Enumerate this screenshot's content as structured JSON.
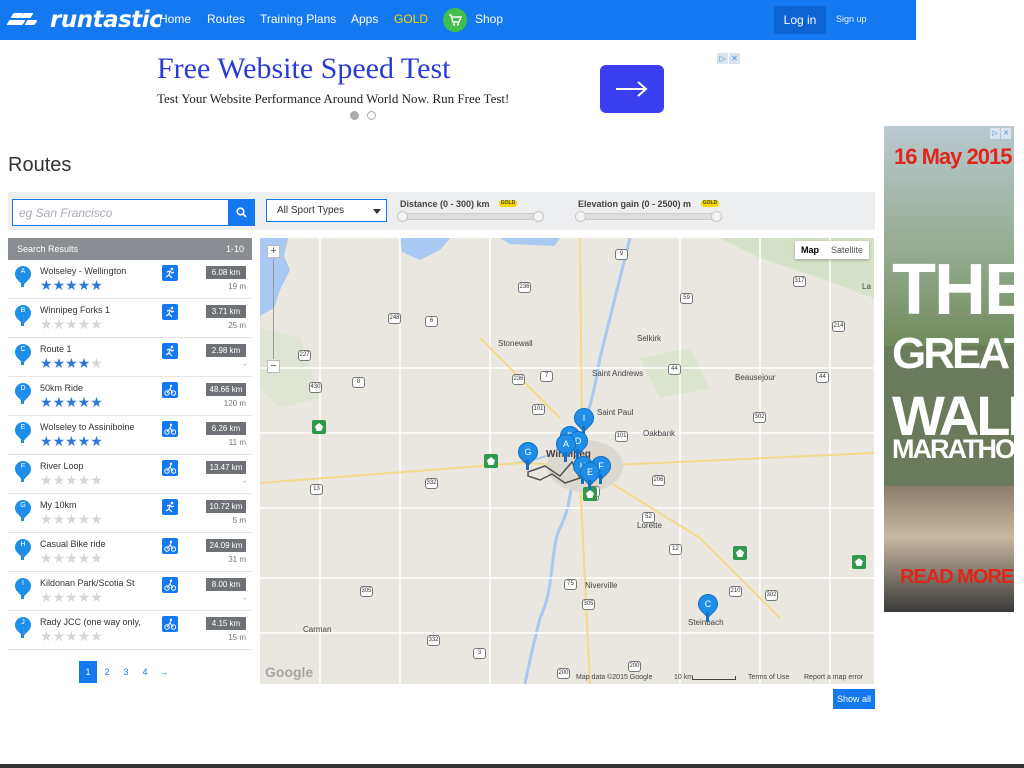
{
  "nav": {
    "brand": "runtastic",
    "links": [
      "Home",
      "Routes",
      "Training Plans",
      "Apps",
      "GOLD",
      "Shop"
    ],
    "login": "Log in",
    "signup": "Sign up"
  },
  "ad_top": {
    "title": "Free Website Speed Test",
    "subtitle": "Test Your Website Performance Around World Now. Run Free Test!"
  },
  "page_title": "Routes",
  "filters": {
    "search_placeholder": "eg San Francisco",
    "sport_select": "All Sport Types",
    "distance_label": "Distance (0 - 300) km",
    "elevation_label": "Elevation gain (0 - 2500) m",
    "gold_badge": "GOLD"
  },
  "results": {
    "header_label": "Search Results",
    "header_range": "1-10",
    "items": [
      {
        "letter": "A",
        "name": "Wolseley - Wellington",
        "stars": 4.5,
        "sport": "running",
        "distance": "6.08 km",
        "elevation": "19 m"
      },
      {
        "letter": "B",
        "name": "Winnipeg Forks 1",
        "stars": 0,
        "sport": "running",
        "distance": "3.71 km",
        "elevation": "25 m"
      },
      {
        "letter": "C",
        "name": "Route 1",
        "stars": 4,
        "sport": "running",
        "distance": "2.98 km",
        "elevation": "-"
      },
      {
        "letter": "D",
        "name": "50km Ride",
        "stars": 5,
        "sport": "cycling",
        "distance": "48.66 km",
        "elevation": "120 m"
      },
      {
        "letter": "E",
        "name": "Wolseley to Assiniboine",
        "stars": 5,
        "sport": "cycling",
        "distance": "6.26 km",
        "elevation": "11 m"
      },
      {
        "letter": "F",
        "name": "River Loop",
        "stars": 0,
        "sport": "cycling",
        "distance": "13.47 km",
        "elevation": "-"
      },
      {
        "letter": "G",
        "name": "My 10km",
        "stars": 0,
        "sport": "running",
        "distance": "10.72 km",
        "elevation": "5 m"
      },
      {
        "letter": "H",
        "name": "Casual Bike ride",
        "stars": 0,
        "sport": "cycling",
        "distance": "24.09 km",
        "elevation": "31 m"
      },
      {
        "letter": "I",
        "name": "Kildonan Park/Scotia St",
        "stars": 0,
        "sport": "cycling",
        "distance": "8.00 km",
        "elevation": "-"
      },
      {
        "letter": "J",
        "name": "Rady JCC (one way only,",
        "stars": 0,
        "sport": "cycling",
        "distance": "4.15 km",
        "elevation": "15 m"
      }
    ]
  },
  "pagination": [
    "1",
    "2",
    "3",
    "4",
    "→"
  ],
  "map": {
    "type_map": "Map",
    "type_satellite": "Satellite",
    "zoom_in": "+",
    "zoom_out": "−",
    "towns": [
      "Stonewall",
      "Selkirk",
      "Saint Andrews",
      "Beausejour",
      "Saint Paul",
      "Oakbank",
      "Winnipeg",
      "Lorette",
      "Niverville",
      "Steinbach",
      "Carman",
      "La"
    ],
    "roads": [
      "9",
      "236",
      "59",
      "317",
      "248",
      "6",
      "214",
      "227",
      "236",
      "7",
      "44",
      "44",
      "430",
      "8",
      "101",
      "302",
      "101",
      "13",
      "332",
      "206",
      "100",
      "75",
      "12",
      "210",
      "305",
      "302",
      "305",
      "332",
      "200",
      "200",
      "3",
      "52",
      "1",
      "1",
      "1"
    ],
    "pins": [
      "I",
      "B",
      "D",
      "A",
      "G",
      "H",
      "F",
      "E",
      "C"
    ],
    "attribution": "Map data ©2015 Google",
    "scale": "10 km",
    "terms": "Terms of Use",
    "report": "Report a map error",
    "google": "Google"
  },
  "show_all": "Show all",
  "side_ad": {
    "date": "16 May 2015",
    "line1": "THE",
    "line2": "GREAT",
    "line3": "WALL",
    "line4": "MARATHON",
    "cta": "READ MORE"
  },
  "colors": {
    "brand_blue": "#1478f0",
    "gold": "#f5d800",
    "star_on": "#2f78d8",
    "pin_blue": "#1e8ee8",
    "ad_red": "#e0261b"
  }
}
